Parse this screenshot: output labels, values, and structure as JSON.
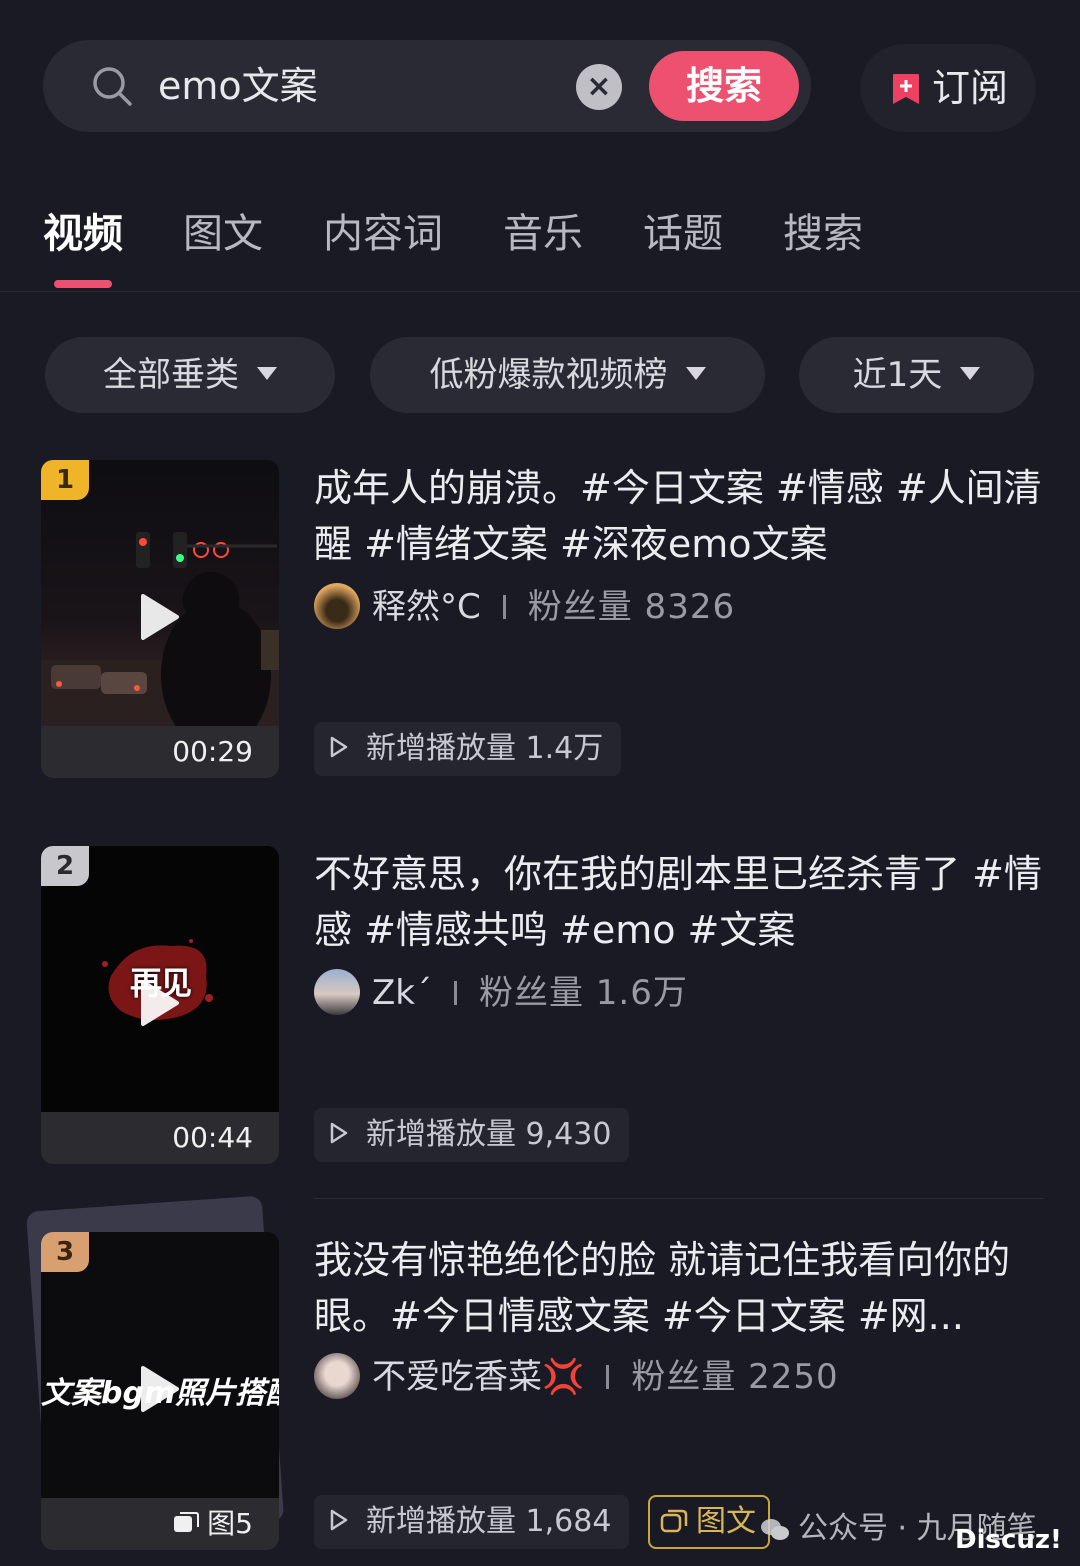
{
  "search": {
    "query": "emo文案",
    "button_label": "搜索",
    "subscribe_label": "订阅"
  },
  "tabs": [
    {
      "label": "视频",
      "active": true
    },
    {
      "label": "图文",
      "active": false
    },
    {
      "label": "内容词",
      "active": false
    },
    {
      "label": "音乐",
      "active": false
    },
    {
      "label": "话题",
      "active": false
    },
    {
      "label": "搜索",
      "active": false
    }
  ],
  "filters": {
    "category": "全部垂类",
    "ranking": "低粉爆款视频榜",
    "period": "近1天"
  },
  "accent_color": "#ee5070",
  "items": [
    {
      "rank": "1",
      "duration": "00:29",
      "title": "成年人的崩溃。#今日文案 #情感 #人间清醒 #情绪文案 #深夜emo文案",
      "author": "释然°C",
      "fans": "粉丝量 8326",
      "plays": "新增播放量 1.4万"
    },
    {
      "rank": "2",
      "duration": "00:44",
      "thumb_text": "再见",
      "title": "不好意思，你在我的剧本里已经杀青了 #情感 #情感共鸣 #emo #文案",
      "author": "Zk´",
      "fans": "粉丝量 1.6万",
      "plays": "新增播放量 9,430"
    },
    {
      "rank": "3",
      "image_count": "图5",
      "thumb_text": "文案bgm照片搭配",
      "title": "我没有惊艳绝伦的脸 就请记住我看向你的眼。#今日情感文案 #今日文案 #网...",
      "author": "不爱吃香菜💢",
      "fans": "粉丝量 2250",
      "plays": "新增播放量 1,684",
      "type_tag": "图文"
    }
  ],
  "watermark": {
    "text": "公众号 · 九月随笔",
    "site": "Discuz!"
  }
}
